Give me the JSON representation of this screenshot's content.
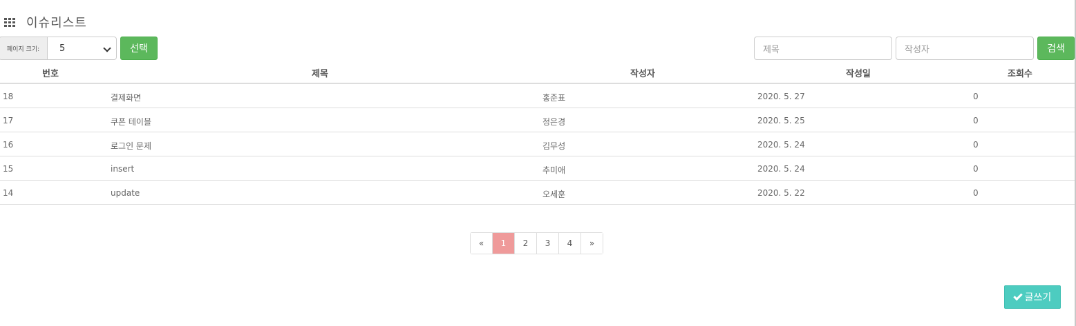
{
  "header": {
    "title": "이슈리스트",
    "icon": "grid-icon"
  },
  "controls": {
    "page_size_label": "페이지 크기:",
    "page_size_value": "5",
    "select_button": "선택",
    "title_placeholder": "제목",
    "writer_placeholder": "작성자",
    "search_button": "검색"
  },
  "table": {
    "columns": [
      "번호",
      "제목",
      "작성자",
      "작성일",
      "조회수"
    ],
    "rows": [
      {
        "no": "18",
        "title": "결제화면",
        "writer": "홍준표",
        "date": "2020. 5. 27",
        "views": "0"
      },
      {
        "no": "17",
        "title": "쿠폰 테이블",
        "writer": "정은경",
        "date": "2020. 5. 25",
        "views": "0"
      },
      {
        "no": "16",
        "title": "로그인 문제",
        "writer": "김무성",
        "date": "2020. 5. 24",
        "views": "0"
      },
      {
        "no": "15",
        "title": "insert",
        "writer": "추미애",
        "date": "2020. 5. 24",
        "views": "0"
      },
      {
        "no": "14",
        "title": "update",
        "writer": "오세훈",
        "date": "2020. 5. 22",
        "views": "0"
      }
    ]
  },
  "pagination": {
    "prev": "«",
    "pages": [
      "1",
      "2",
      "3",
      "4"
    ],
    "next": "»",
    "current": "1"
  },
  "write_button": {
    "label": "글쓰기",
    "icon": "check-icon"
  },
  "colors": {
    "green": "#5cb85c",
    "active_page": "#ef9a9a",
    "teal": "#4dccc0"
  }
}
